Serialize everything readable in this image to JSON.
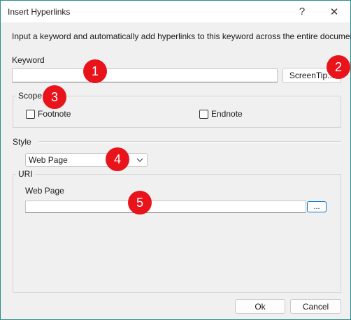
{
  "window": {
    "title": "Insert Hyperlinks",
    "help_glyph": "?",
    "close_glyph": "✕"
  },
  "description": "Input a keyword and automatically add hyperlinks to this keyword across the entire document.",
  "keyword": {
    "label": "Keyword",
    "value": "",
    "screentip_label": "ScreenTip..."
  },
  "scope": {
    "title": "Scope",
    "options": [
      {
        "label": "Footnote",
        "checked": false
      },
      {
        "label": "Endnote",
        "checked": false
      }
    ]
  },
  "style": {
    "title": "Style",
    "selected": "Web Page"
  },
  "uri": {
    "title": "URI",
    "field_label": "Web Page",
    "value": "",
    "browse_label": "..."
  },
  "footer": {
    "ok_label": "Ok",
    "cancel_label": "Cancel"
  },
  "badges": [
    "1",
    "2",
    "3",
    "4",
    "5"
  ],
  "colors": {
    "badge": "#e8131b",
    "window_border": "#2a8c8c",
    "browse_button_border": "#0078d4"
  }
}
